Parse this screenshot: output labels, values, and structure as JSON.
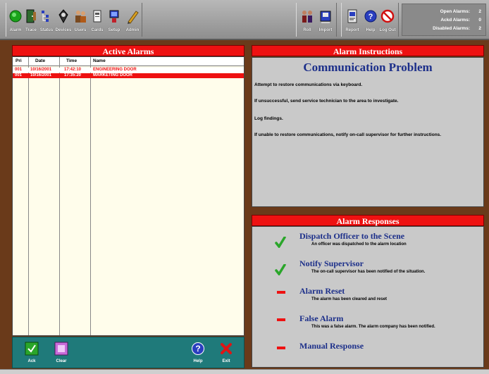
{
  "toolbar": {
    "left_buttons": [
      {
        "label": "Alarm",
        "icon": "alarm-light-icon"
      },
      {
        "label": "Trace",
        "icon": "door-icon"
      },
      {
        "label": "Status",
        "icon": "status-tree-icon"
      },
      {
        "label": "Devices",
        "icon": "devices-icon"
      },
      {
        "label": "Users",
        "icon": "users-icon"
      },
      {
        "label": "Cards",
        "icon": "cards-icon"
      },
      {
        "label": "Setup",
        "icon": "setup-icon"
      },
      {
        "label": "Admin",
        "icon": "pencil-icon"
      }
    ],
    "right_buttons": [
      {
        "label": "Roll",
        "icon": "roll-call-icon"
      },
      {
        "label": "Import",
        "icon": "import-icon"
      },
      {
        "label": "Report",
        "icon": "report-icon"
      },
      {
        "label": "Help",
        "icon": "help-icon"
      },
      {
        "label": "Log Out",
        "icon": "logout-icon"
      }
    ]
  },
  "status": {
    "open_label": "Open Alarms:",
    "open_value": "2",
    "acked_label": "Ackd Alarms:",
    "acked_value": "0",
    "disabled_label": "Disabled Alarms:",
    "disabled_value": "2"
  },
  "active_alarms": {
    "title": "Active Alarms",
    "columns": [
      "Pri",
      "Date",
      "Time",
      "Name"
    ],
    "rows": [
      {
        "pri": "001",
        "date": "10/16/2001",
        "time": "17:42:10",
        "name": "ENGINEERING DOOR"
      },
      {
        "pri": "001",
        "date": "10/16/2001",
        "time": "17:35:20",
        "name": "MARKETING DOOR"
      }
    ],
    "buttons": [
      {
        "label": "Ack",
        "icon": "ack-icon"
      },
      {
        "label": "Clear",
        "icon": "clear-icon"
      },
      {
        "label": "Help",
        "icon": "help-icon"
      },
      {
        "label": "Exit",
        "icon": "exit-icon"
      }
    ]
  },
  "instructions": {
    "header": "Alarm Instructions",
    "title": "Communication Problem",
    "lines": [
      "Attempt to restore communications via keyboard.",
      "If unsuccessful, send service technician to the area to investigate.",
      "Log findings.",
      "If unable to restore communications, notify on-call supervisor for further instructions."
    ]
  },
  "responses": {
    "header": "Alarm Responses",
    "items": [
      {
        "title": "Dispatch Officer to the Scene",
        "desc": "An officer was dispatched to the alarm location",
        "status": "done"
      },
      {
        "title": "Notify Supervisor",
        "desc": "The on-call supervisor has been notified of the situation.",
        "status": "done"
      },
      {
        "title": "Alarm Reset",
        "desc": "The alarm has been cleared and reset",
        "status": "pending"
      },
      {
        "title": "False Alarm",
        "desc": "This was a false alarm. The alarm company has been notified.",
        "status": "pending"
      },
      {
        "title": "Manual Response",
        "desc": "",
        "status": "pending"
      }
    ]
  },
  "colors": {
    "accent_red": "#ee1111",
    "title_blue": "#1c2f8a",
    "toolbar_gray": "#9a9a9a",
    "frame_brown": "#6a3a1a",
    "teal": "#1f7a7a",
    "check_green": "#2aa62a"
  }
}
